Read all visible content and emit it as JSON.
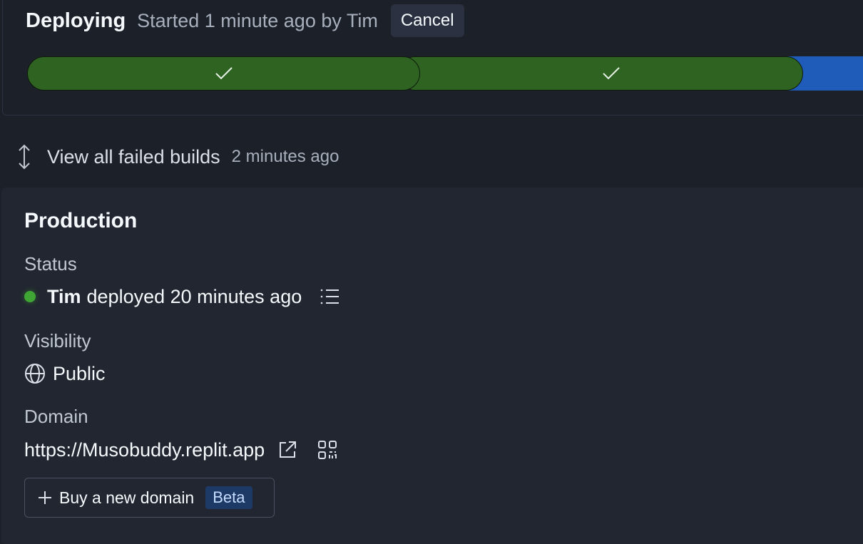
{
  "deploy": {
    "title": "Deploying",
    "meta": "Started 1 minute ago by Tim",
    "cancel_label": "Cancel",
    "steps": [
      {
        "state": "complete",
        "icon": "check-icon"
      },
      {
        "state": "complete",
        "icon": "check-icon"
      },
      {
        "state": "in-progress"
      }
    ]
  },
  "failed_builds": {
    "label": "View all failed builds",
    "time": "2 minutes ago",
    "icon": "expand-vertical-icon"
  },
  "production": {
    "title": "Production",
    "status_label": "Status",
    "status_user": "Tim",
    "status_text": "deployed 20 minutes ago",
    "status_color": "#3fa535",
    "visibility_label": "Visibility",
    "visibility_value": "Public",
    "domain_label": "Domain",
    "domain_url": "https://Musobuddy.replit.app",
    "buy_domain_label": "Buy a new domain",
    "beta_label": "Beta"
  },
  "colors": {
    "background": "#1c2029",
    "card": "#222631",
    "success": "#2e6322",
    "progress": "#1f5bb8"
  }
}
